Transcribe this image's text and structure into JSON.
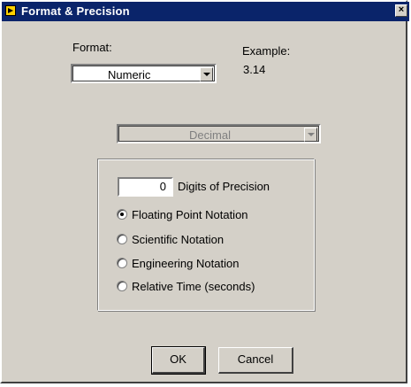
{
  "window": {
    "title": "Format & Precision",
    "close_glyph": "×"
  },
  "format": {
    "label": "Format:",
    "selected": "Numeric"
  },
  "example": {
    "label": "Example:",
    "value": "3.14"
  },
  "base": {
    "selected": "Decimal",
    "enabled": false
  },
  "precision": {
    "digits": "0",
    "label": "Digits of Precision"
  },
  "notation": {
    "options": [
      {
        "label": "Floating Point Notation",
        "checked": true
      },
      {
        "label": "Scientific Notation",
        "checked": false
      },
      {
        "label": "Engineering Notation",
        "checked": false
      },
      {
        "label": "Relative Time (seconds)",
        "checked": false
      }
    ]
  },
  "buttons": {
    "ok": "OK",
    "cancel": "Cancel"
  },
  "icons": {
    "app": "app-icon",
    "close": "close-icon",
    "dropdown": "chevron-down-icon"
  },
  "colors": {
    "titlebar": "#0a246a",
    "face": "#d4d0c8"
  }
}
